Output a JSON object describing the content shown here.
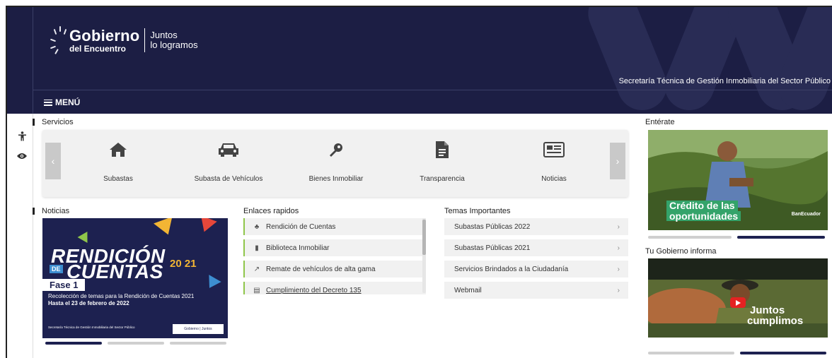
{
  "header": {
    "logo_line1": "Gobierno",
    "logo_line2": "del Encuentro",
    "slogan_line1": "Juntos",
    "slogan_line2": "lo logramos",
    "institution": "Secretaría Técnica de Gestión Inmobiliaria del Sector Público",
    "menu_label": "MENÚ"
  },
  "services": {
    "section_title": "Servicios",
    "items": [
      {
        "label": "Subastas",
        "icon": "home-icon"
      },
      {
        "label": "Subasta de Vehículos",
        "icon": "car-icon"
      },
      {
        "label": "Bienes Inmobiliar",
        "icon": "key-icon"
      },
      {
        "label": "Transparencia",
        "icon": "document-icon"
      },
      {
        "label": "Noticias",
        "icon": "newspaper-icon"
      }
    ],
    "prev_label": "‹",
    "next_label": "›"
  },
  "news": {
    "section_title": "Noticias",
    "banner_title_1": "RENDICIÓN",
    "banner_title_de": "DE",
    "banner_title_2": "CUENTAS",
    "banner_year": "20 21",
    "banner_phase": "Fase 1",
    "banner_line1": "Recolección de temas para la Rendición de Cuentas 2021",
    "banner_line2": "Hasta el 23 de febrero de 2022",
    "banner_footer": "Secretaría Técnica de Gestión Inmobiliaria del Sector Público",
    "banner_mini_logo": "Gobierno | Juntos"
  },
  "links": {
    "section_title": "Enlaces rapidos",
    "items": [
      {
        "label": "Rendición de Cuentas",
        "icon": "people-icon"
      },
      {
        "label": "Biblioteca Inmobiliar",
        "icon": "book-icon"
      },
      {
        "label": "Remate de vehículos de alta gama",
        "icon": "gavel-icon"
      },
      {
        "label": "Cumplimiento del Decreto 135",
        "icon": "file-icon"
      }
    ]
  },
  "topics": {
    "section_title": "Temas Importantes",
    "items": [
      {
        "label": "Subastas Públicas 2022"
      },
      {
        "label": "Subastas Públicas 2021"
      },
      {
        "label": "Servicios Brindados a la Ciudadanía"
      },
      {
        "label": "Webmail"
      }
    ],
    "chevron": "›"
  },
  "right": {
    "enterate_title": "Entérate",
    "promo1_line1": "Crédito de las",
    "promo1_line2": "oportunidades",
    "promo1_brand": "BanEcuador",
    "gov_informs_title": "Tu Gobierno informa",
    "promo2_line1": "Juntos",
    "promo2_line2": "cumplimos"
  },
  "colors": {
    "header_bg": "#1c1e44",
    "accent_green": "#8fc64a",
    "banner_blue": "#1d2150"
  }
}
